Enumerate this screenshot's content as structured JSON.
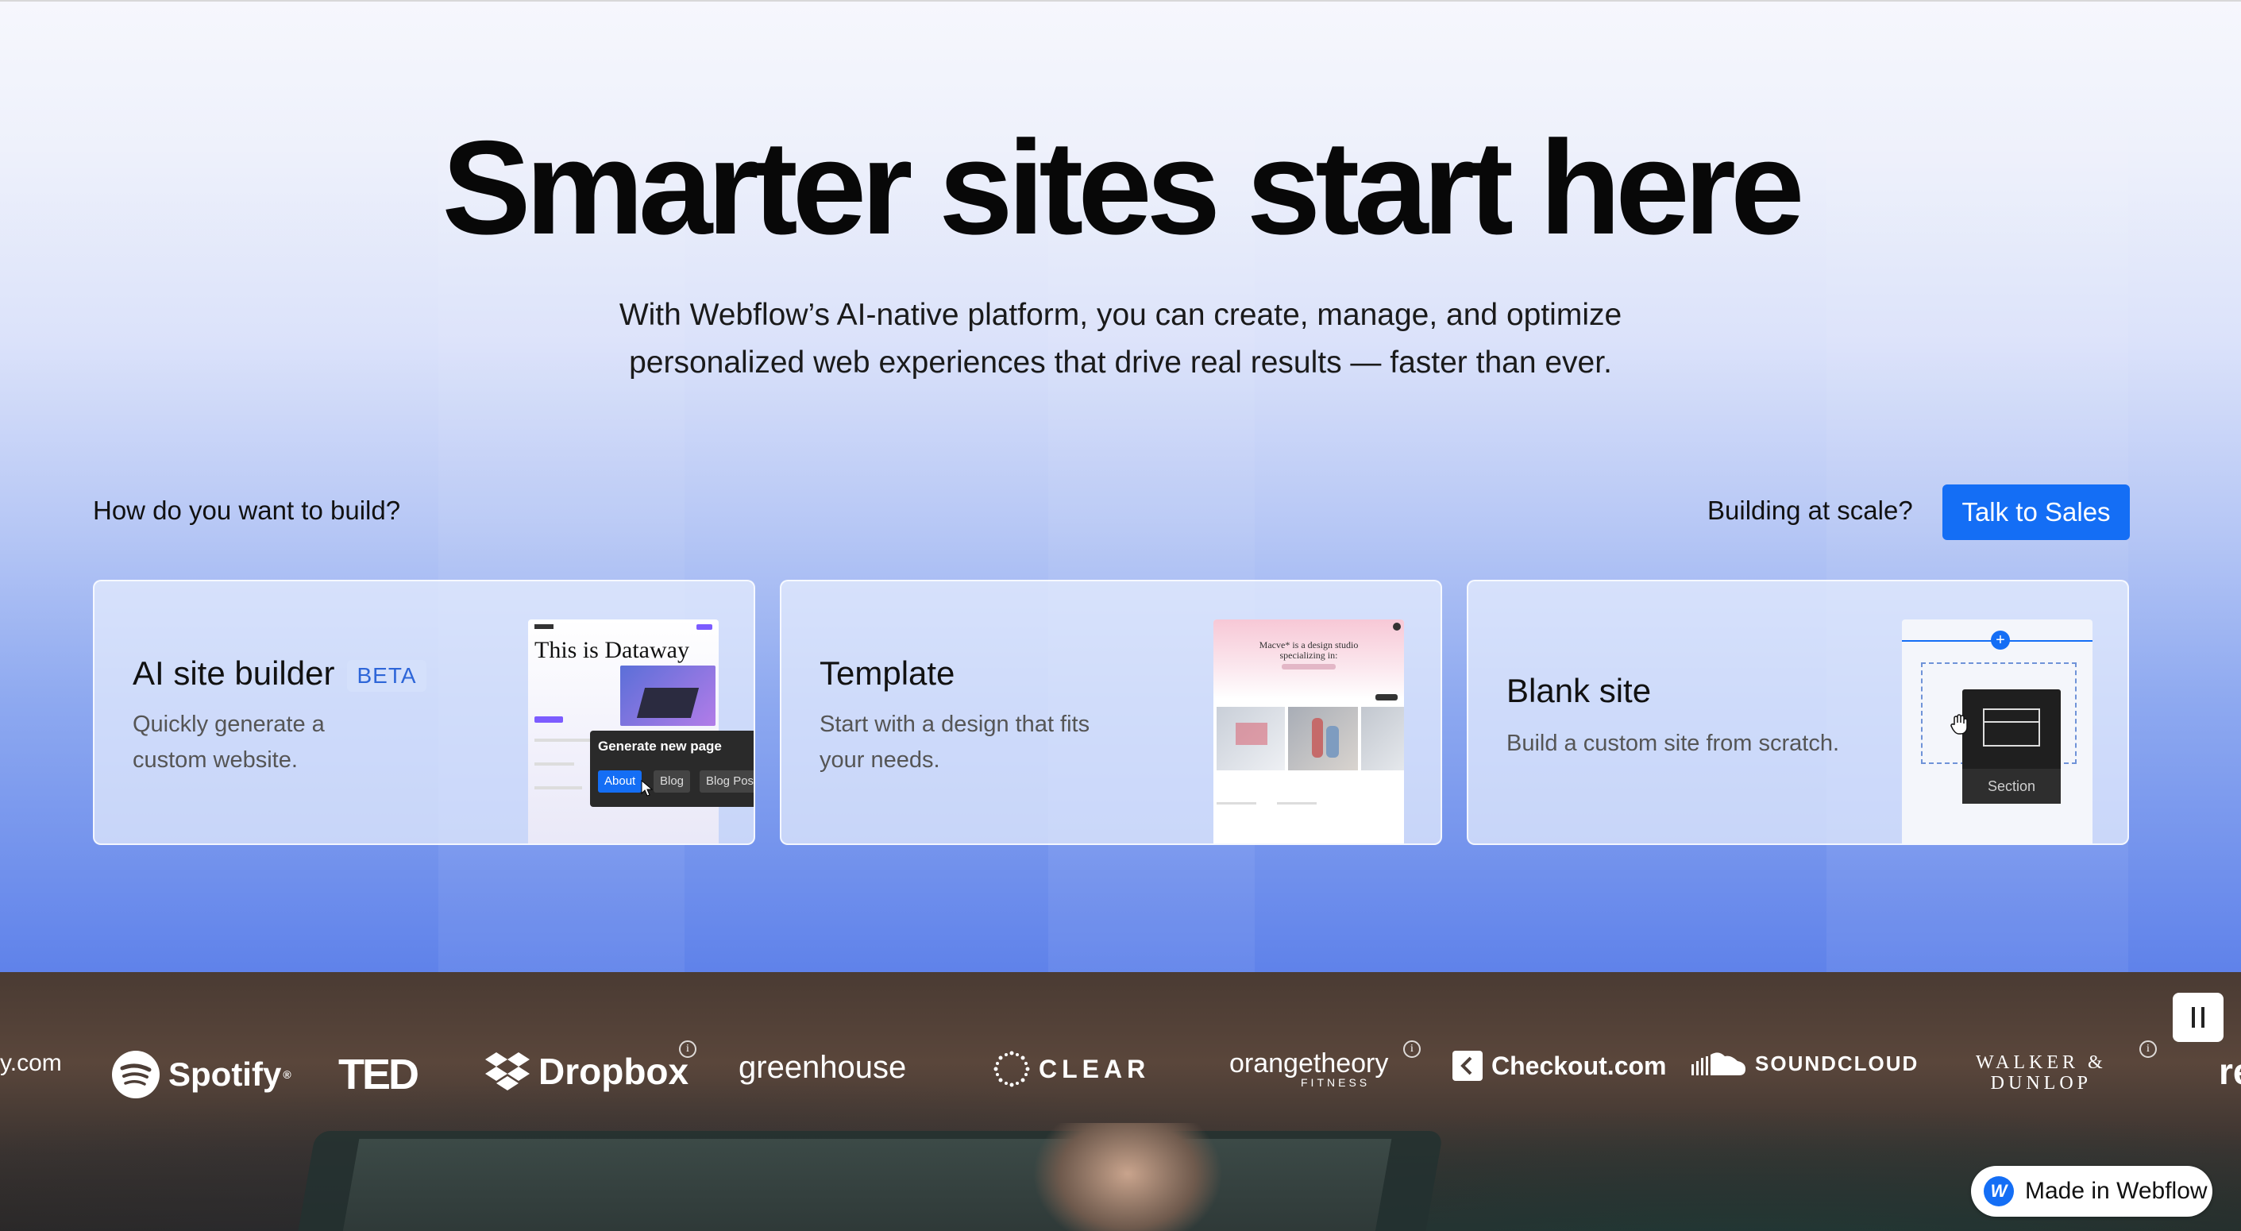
{
  "hero": {
    "headline": "Smarter sites start here",
    "subtitle_line1": "With Webflow’s AI-native platform, you can create, manage, and optimize",
    "subtitle_line2": "personalized web experiences that drive real results — faster than ever."
  },
  "build": {
    "question": "How do you want to build?",
    "scale_question": "Building at scale?",
    "sales_button": "Talk to Sales"
  },
  "cards": [
    {
      "title": "AI site builder",
      "badge": "BETA",
      "desc_line1": "Quickly generate a",
      "desc_line2": "custom website.",
      "preview": {
        "site_title": "This is Dataway",
        "popup_title": "Generate new page",
        "chips": [
          "About",
          "Blog",
          "Blog Post"
        ]
      }
    },
    {
      "title": "Template",
      "desc_line1": "Start with a design that fits",
      "desc_line2": "your needs.",
      "preview": {
        "headline": "Macve* is a design studio specializing in:"
      }
    },
    {
      "title": "Blank site",
      "desc_line1": "Build a custom site from scratch.",
      "preview": {
        "section_label": "Section"
      }
    }
  ],
  "logos": [
    {
      "text": "y.com"
    },
    {
      "text": "Spotify",
      "suffix": "®"
    },
    {
      "text": "TED"
    },
    {
      "text": "Dropbox"
    },
    {
      "text": "greenhouse"
    },
    {
      "text": "CLEAR"
    },
    {
      "text": "orangetheory",
      "sub": "FITNESS"
    },
    {
      "text": "Checkout.com"
    },
    {
      "text": "SOUNDCLOUD"
    },
    {
      "text": "WALKER &",
      "text2": "DUNLOP"
    },
    {
      "text": "re"
    }
  ],
  "badge": {
    "label": "Made in Webflow",
    "mark": "W"
  },
  "colors": {
    "accent": "#146ef5",
    "hero_bottom": "#5f82ea"
  }
}
